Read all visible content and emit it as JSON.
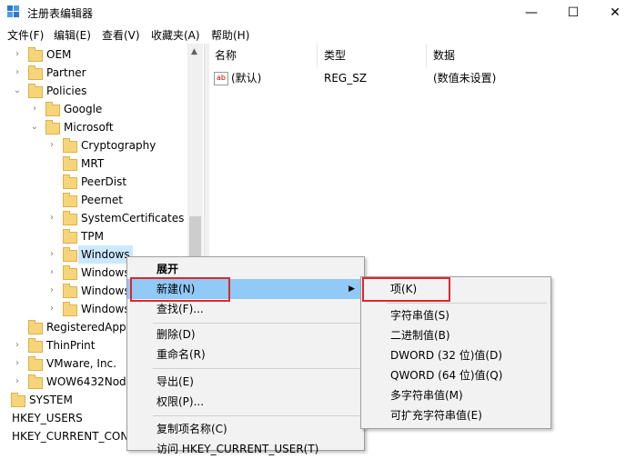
{
  "window": {
    "title": "注册表编辑器",
    "min_icon": "minimize-icon",
    "max_icon": "maximize-icon",
    "close_icon": "close-icon"
  },
  "menubar": [
    "文件(F)",
    "编辑(E)",
    "查看(V)",
    "收藏夹(A)",
    "帮助(H)"
  ],
  "tree": {
    "nodes": [
      {
        "label": "OEM"
      },
      {
        "label": "Partner"
      },
      {
        "label": "Policies"
      },
      {
        "label": "Google"
      },
      {
        "label": "Microsoft"
      },
      {
        "label": "Cryptography"
      },
      {
        "label": "MRT"
      },
      {
        "label": "PeerDist"
      },
      {
        "label": "Peernet"
      },
      {
        "label": "SystemCertificates"
      },
      {
        "label": "TPM"
      },
      {
        "label": "Windows"
      },
      {
        "label": "Windows"
      },
      {
        "label": "Windows"
      },
      {
        "label": "Windows"
      },
      {
        "label": "RegisteredApp"
      },
      {
        "label": "ThinPrint"
      },
      {
        "label": "VMware, Inc."
      },
      {
        "label": "WOW6432Nod"
      },
      {
        "label": "SYSTEM"
      },
      {
        "label": "HKEY_USERS"
      },
      {
        "label": "HKEY_CURRENT_CON"
      }
    ]
  },
  "list": {
    "headers": {
      "name": "名称",
      "type": "类型",
      "data": "数据"
    },
    "rows": [
      {
        "name": "(默认)",
        "type": "REG_SZ",
        "data": "(数值未设置)"
      }
    ]
  },
  "context_menu": {
    "expand": "展开",
    "new": "新建(N)",
    "find": "查找(F)...",
    "delete": "删除(D)",
    "rename": "重命名(R)",
    "export": "导出(E)",
    "permissions": "权限(P)...",
    "copy_key": "复制项名称(C)",
    "visit": "访问 HKEY_CURRENT_USER(T)"
  },
  "submenu": {
    "key": "项(K)",
    "string": "字符串值(S)",
    "binary": "二进制值(B)",
    "dword": "DWORD (32 位)值(D)",
    "qword": "QWORD (64 位)值(Q)",
    "multi": "多字符串值(M)",
    "expand_string": "可扩充字符串值(E)"
  },
  "colors": {
    "highlight": "#91c9f7",
    "annotation": "#e0262c",
    "selection": "#cce8ff"
  }
}
